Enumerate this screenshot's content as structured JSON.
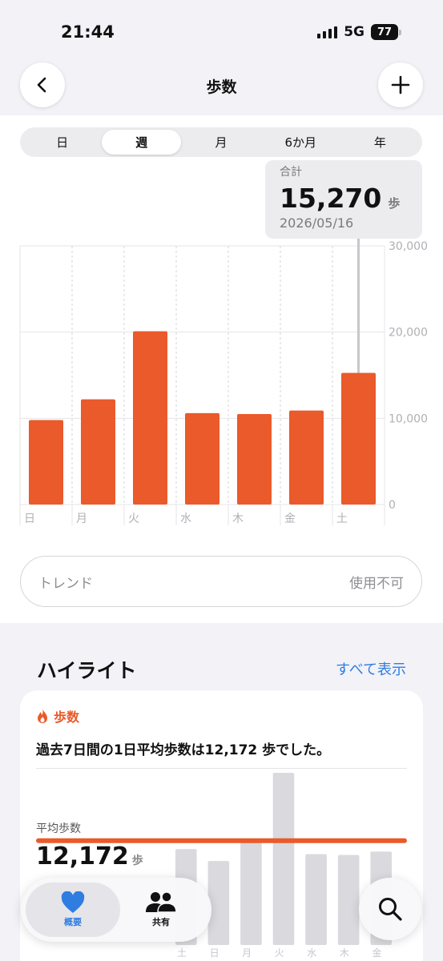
{
  "status": {
    "time": "21:44",
    "network": "5G",
    "battery": "77"
  },
  "nav": {
    "title": "歩数"
  },
  "segments": [
    {
      "label": "日",
      "active": false
    },
    {
      "label": "週",
      "active": true
    },
    {
      "label": "月",
      "active": false
    },
    {
      "label": "6か月",
      "active": false
    },
    {
      "label": "年",
      "active": false
    }
  ],
  "tooltip": {
    "label": "合計",
    "value": "15,270",
    "unit": "歩",
    "date": "2026/05/16"
  },
  "chart_data": {
    "type": "bar",
    "categories": [
      "日",
      "月",
      "火",
      "水",
      "木",
      "金",
      "土"
    ],
    "values": [
      9800,
      12200,
      20100,
      10600,
      10500,
      10900,
      15270
    ],
    "ylim": [
      0,
      30000
    ],
    "yticks": [
      0,
      10000,
      20000,
      30000
    ],
    "ytick_labels": [
      "0",
      "10,000",
      "20,000",
      "30,000"
    ],
    "highlight_index": 6,
    "bar_color": "#ea5a2a"
  },
  "trend": {
    "label": "トレンド",
    "status": "使用不可"
  },
  "highlights": {
    "title": "ハイライト",
    "show_all": "すべて表示",
    "card": {
      "category": "歩数",
      "sentence": "過去7日間の1日平均歩数は12,172 歩でした。",
      "avg_label": "平均歩数",
      "avg_value": "12,172",
      "avg_unit": "歩",
      "mini_chart": {
        "categories": [
          "土",
          "日",
          "月",
          "火",
          "水",
          "木",
          "金"
        ],
        "values": [
          11200,
          9800,
          12000,
          20100,
          10600,
          10500,
          10900
        ],
        "average": 12172,
        "avg_color": "#ea5a2a",
        "bar_color": "#d9d9de"
      }
    }
  },
  "tabbar": {
    "summary_label": "概要",
    "sharing_label": "共有",
    "accent": "#2f7de1"
  }
}
